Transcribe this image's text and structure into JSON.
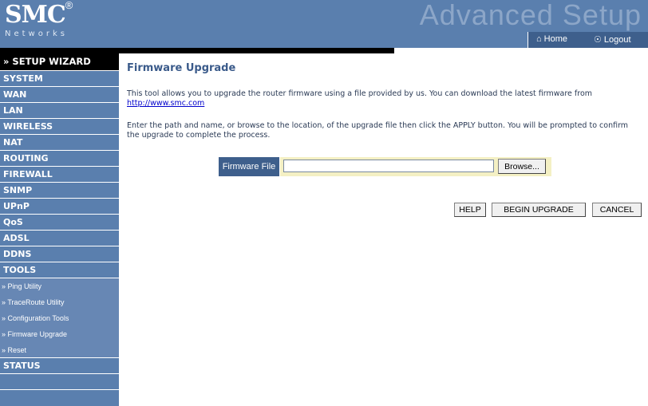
{
  "header": {
    "logo_main": "SMC",
    "logo_reg": "®",
    "logo_sub": "Networks",
    "banner": "Advanced Setup",
    "home_label": "Home",
    "logout_label": "Logout",
    "home_icon": "house-icon",
    "logout_icon": "power-icon"
  },
  "sidebar": {
    "wizard": "» SETUP WIZARD",
    "items": [
      "SYSTEM",
      "WAN",
      "LAN",
      "WIRELESS",
      "NAT",
      "ROUTING",
      "FIREWALL",
      "SNMP",
      "UPnP",
      "QoS",
      "ADSL",
      "DDNS",
      "TOOLS"
    ],
    "tools_sub": [
      "» Ping Utility",
      "» TraceRoute Utility",
      "» Configuration Tools",
      "» Firmware Upgrade",
      "» Reset"
    ],
    "status": "STATUS"
  },
  "main": {
    "title": "Firmware Upgrade",
    "p1_text": "This tool allows you to upgrade the router firmware using a file provided by us. You can download the latest firmware from ",
    "p1_link": "http://www.smc.com",
    "p2_text": "Enter the path and name, or browse to the location, of the upgrade file then click the APPLY button. You will be prompted to confirm the upgrade to complete the process.",
    "firmware_label": "Firmware File",
    "firmware_value": "",
    "browse_label": "Browse...",
    "help_label": "HELP",
    "begin_label": "BEGIN UPGRADE",
    "cancel_label": "CANCEL"
  },
  "colors": {
    "sidebar_bg": "#5a7fae",
    "header_bg": "#5a7fae",
    "title_color": "#3a5a8a",
    "label_bg": "#3e5f8c",
    "field_bg": "#f4f0c4"
  }
}
